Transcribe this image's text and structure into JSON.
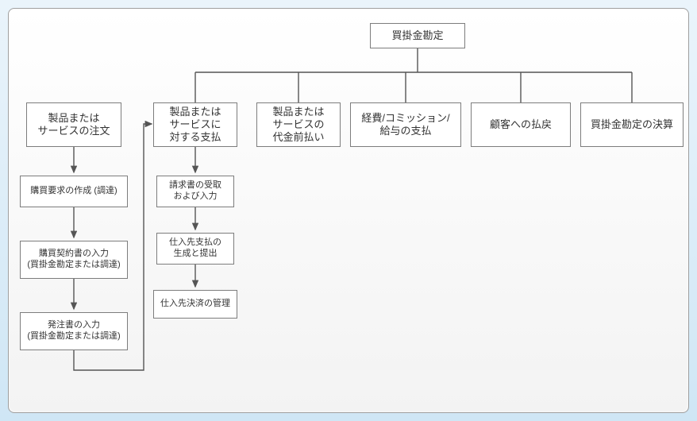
{
  "diagram": {
    "root": "買掛金勘定",
    "branches": {
      "b1": "製品または\nサービスに\n対する支払",
      "b2": "製品または\nサービスの\n代金前払い",
      "b3": "経費/コミッション/\n給与の支払",
      "b4": "顧客への払戻",
      "b5": "買掛金勘定の決算"
    },
    "leftChain": {
      "l0": "製品または\nサービスの注文",
      "l1": "購買要求の作成 (調達)",
      "l2": "購買契約書の入力\n(買掛金勘定または調達)",
      "l3": "発注書の入力\n(買掛金勘定または調達)"
    },
    "b1Sub": {
      "s1": "請求書の受取\nおよび入力",
      "s2": "仕入先支払の\n生成と提出",
      "s3": "仕入先決済の管理"
    }
  }
}
